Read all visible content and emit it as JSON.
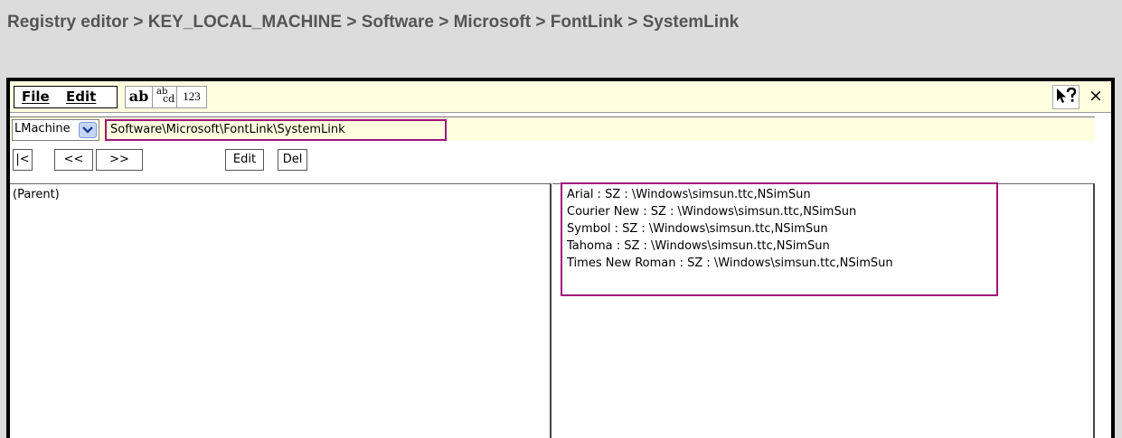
{
  "caption": "Registry editor > KEY_LOCAL_MACHINE > Software > Microsoft > FontLink > SystemLink",
  "menu": {
    "file": "File",
    "edit": "Edit"
  },
  "ime": {
    "ab": "ab",
    "abcd_top": "ab",
    "abcd_bottom": "cd",
    "num": "123"
  },
  "window_controls": {
    "help_icon": "pointer-question-icon",
    "close_label": "×"
  },
  "path": {
    "hive": "LMachine",
    "key_path": "Software\\Microsoft\\FontLink\\SystemLink"
  },
  "nav": {
    "first": "|<",
    "prev": "<<",
    "next": ">>",
    "edit": "Edit",
    "del": "Del"
  },
  "keys": [
    "(Parent)"
  ],
  "values": [
    "Arial : SZ : \\Windows\\simsun.ttc,NSimSun",
    "Courier New : SZ : \\Windows\\simsun.ttc,NSimSun",
    "Symbol : SZ : \\Windows\\simsun.ttc,NSimSun",
    "Tahoma : SZ : \\Windows\\simsun.ttc,NSimSun",
    "Times New Roman : SZ : \\Windows\\simsun.ttc,NSimSun"
  ],
  "colors": {
    "highlight": "#a0147a",
    "toolbar_bg": "#ffffe0",
    "page_bg": "#dcdcdc"
  }
}
